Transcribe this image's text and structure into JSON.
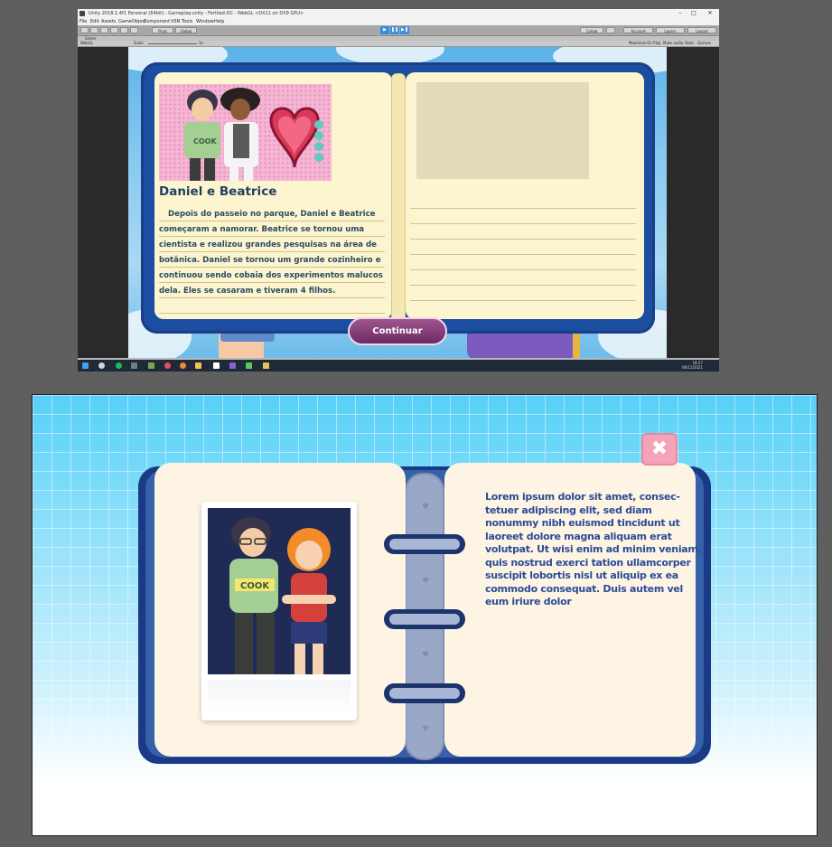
{
  "unity": {
    "title": "Unity 2018.1.4f1 Personal (64bit) - Gameplay.unity - Fertilad-DC - WebGL <DX11 on DX9 GPU>",
    "menu": [
      "File",
      "Edit",
      "Assets",
      "GameObject",
      "Component",
      "VSN",
      "Tools",
      "Window",
      "Help"
    ],
    "toolbar": {
      "pivot": "Pivot",
      "global": "Global",
      "account": "Account",
      "layers": "Layers",
      "layout": "Layout",
      "collab": "Collab"
    },
    "game_tab": "Game",
    "game_bar": {
      "display": "WebGL",
      "scale_label": "Scale",
      "scale_value": "1x",
      "maximize": "Maximize On Play",
      "mute": "Mute audio",
      "stats": "Stats",
      "gizmos": "Gizmos"
    },
    "card": {
      "title": "Daniel e Beatrice",
      "lines": [
        "Depois do passeio no parque, Daniel e Beatrice",
        "começaram a namorar. Beatrice se tornou uma",
        "cientista e realizou grandes pesquisas na área de",
        "botânica. Daniel se tornou um grande cozinheiro e",
        "continuou sendo cobaia dos experimentos malucos",
        "dela. Eles se casaram e tiveram 4 filhos."
      ]
    },
    "continue_button": "Continuar",
    "taskbar": {
      "time": "18:27",
      "date": "06/11/2021"
    }
  },
  "mock": {
    "lorem_lines": [
      "Lorem ipsum dolor sit amet, consec-",
      "tetuer adipiscing elit, sed diam",
      "nonummy nibh euismod tincidunt ut",
      "laoreet dolore magna aliquam erat",
      "volutpat. Ut wisi enim ad minim veniam,",
      "quis nostrud exerci tation ullamcorper",
      "suscipit lobortis nisl ut aliquip ex ea",
      "commodo consequat. Duis autem vel",
      "eum iriure dolor"
    ],
    "close_glyph": "✖"
  },
  "colors": {
    "book_blue": "#1b4da0",
    "page_cream": "#fdf5cf",
    "button_purple": "#8c4580",
    "mock_cover": "#1b3a86",
    "lorem_text": "#2c4b95",
    "close_pink": "#f4a3b9"
  }
}
